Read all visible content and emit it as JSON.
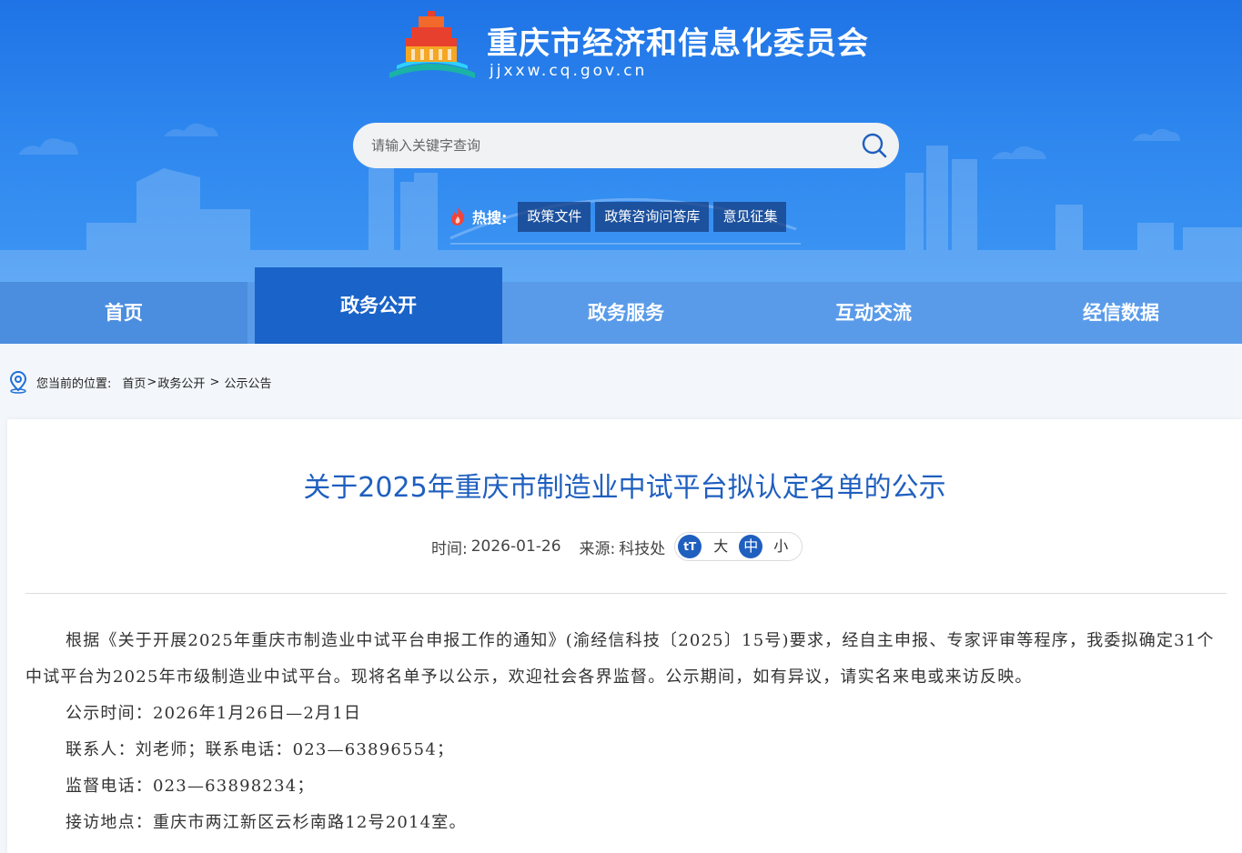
{
  "site": {
    "title": "重庆市经济和信息化委员会",
    "domain": "jjxxw.cq.gov.cn"
  },
  "search": {
    "placeholder": "请输入关键字查询"
  },
  "hot": {
    "label": "热搜:",
    "tags": [
      "政策文件",
      "政策咨询问答库",
      "意见征集"
    ]
  },
  "nav": {
    "items": [
      "首页",
      "政务公开",
      "政务服务",
      "互动交流",
      "经信数据"
    ],
    "active": "政务公开"
  },
  "breadcrumb": {
    "label": "您当前的位置:",
    "home": "首页",
    "sep1": ">",
    "section": "政务公开",
    "sep2": " > ",
    "current": "公示公告"
  },
  "article": {
    "title": "关于2025年重庆市制造业中试平台拟认定名单的公示",
    "time_label": "时间:",
    "time": "2026-01-26",
    "source_label": "来源:",
    "source": "科技处",
    "fontsize": {
      "icon": "tT",
      "large": "大",
      "medium": "中",
      "small": "小",
      "selected": "中"
    },
    "paragraph": "根据《关于开展2025年重庆市制造业中试平台申报工作的通知》(渝经信科技〔2025〕15号)要求，经自主申报、专家评审等程序，我委拟确定31个中试平台为2025年市级制造业中试平台。现将名单予以公示，欢迎社会各界监督。公示期间，如有异议，请实名来电或来访反映。",
    "lines": [
      "公示时间：2026年1月26日—2月1日",
      "联系人：刘老师；联系电话：023—63896554；",
      "监督电话：023—63898234；",
      "接访地点：重庆市两江新区云杉南路12号2014室。"
    ]
  },
  "colors": {
    "header_blue": "#1f73e6",
    "nav_blue": "#5a9be9",
    "nav_active": "#1a63c8",
    "title_blue": "#1f5fbf"
  }
}
